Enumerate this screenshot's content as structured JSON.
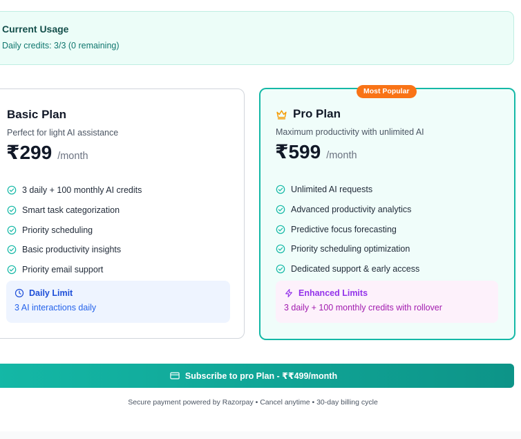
{
  "usage": {
    "title": "Current Usage",
    "text": "Daily credits: 3/3 (0 remaining)"
  },
  "plans": [
    {
      "name": "Basic Plan",
      "description": "Perfect for light AI assistance",
      "price": "₹299",
      "period": "/month",
      "features": [
        "3 daily + 100 monthly AI credits",
        "Smart task categorization",
        "Priority scheduling",
        "Basic productivity insights",
        "Priority email support"
      ],
      "limit": {
        "icon": "clock-icon",
        "title": "Daily Limit",
        "text": "3 AI interactions daily"
      }
    },
    {
      "name": "Pro Plan",
      "badge": "Most Popular",
      "icon": "crown-icon",
      "description": "Maximum productivity with unlimited AI",
      "price": "₹599",
      "period": "/month",
      "features": [
        "Unlimited AI requests",
        "Advanced productivity analytics",
        "Predictive focus forecasting",
        "Priority scheduling optimization",
        "Dedicated support & early access"
      ],
      "limit": {
        "icon": "bolt-icon",
        "title": "Enhanced Limits",
        "text": "3 daily + 100 monthly credits with rollover"
      }
    }
  ],
  "subscribe": {
    "icon": "credit-card-icon",
    "label": "Subscribe to pro Plan - ₹₹499/month"
  },
  "footnote": "Secure payment powered by Razorpay • Cancel anytime • 30-day billing cycle",
  "colors": {
    "accent": "#14b8a6",
    "badge": "#f97316",
    "check": "#14b8a6"
  }
}
